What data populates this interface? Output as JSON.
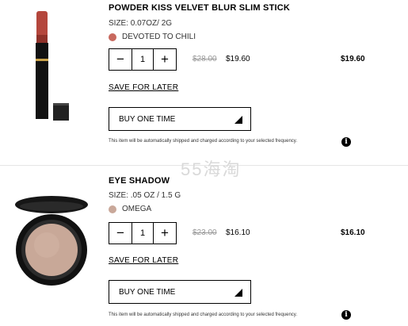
{
  "items": [
    {
      "title": "POWDER KISS VELVET BLUR SLIM STICK",
      "size": "SIZE: 0.07OZ/ 2G",
      "shade_name": "DEVOTED TO CHILI",
      "shade_color": "#c8695e",
      "quantity": "1",
      "original_price": "$28.00",
      "price": "$19.60",
      "total": "$19.60",
      "save_label": "SAVE FOR LATER",
      "purchase_option": "BUY ONE TIME",
      "note": "This item will be automatically shipped and charged according to your selected frequency."
    },
    {
      "title": "EYE SHADOW",
      "size": "SIZE: .05 OZ / 1.5 G",
      "shade_name": "OMEGA",
      "shade_color": "#c9a89a",
      "quantity": "1",
      "original_price": "$23.00",
      "price": "$16.10",
      "total": "$16.10",
      "save_label": "SAVE FOR LATER",
      "purchase_option": "BUY ONE TIME",
      "note": "This item will be automatically shipped and charged according to your selected frequency."
    }
  ],
  "stepper": {
    "minus": "−",
    "plus": "+"
  },
  "info_icon": "i",
  "watermark": "55海淘"
}
